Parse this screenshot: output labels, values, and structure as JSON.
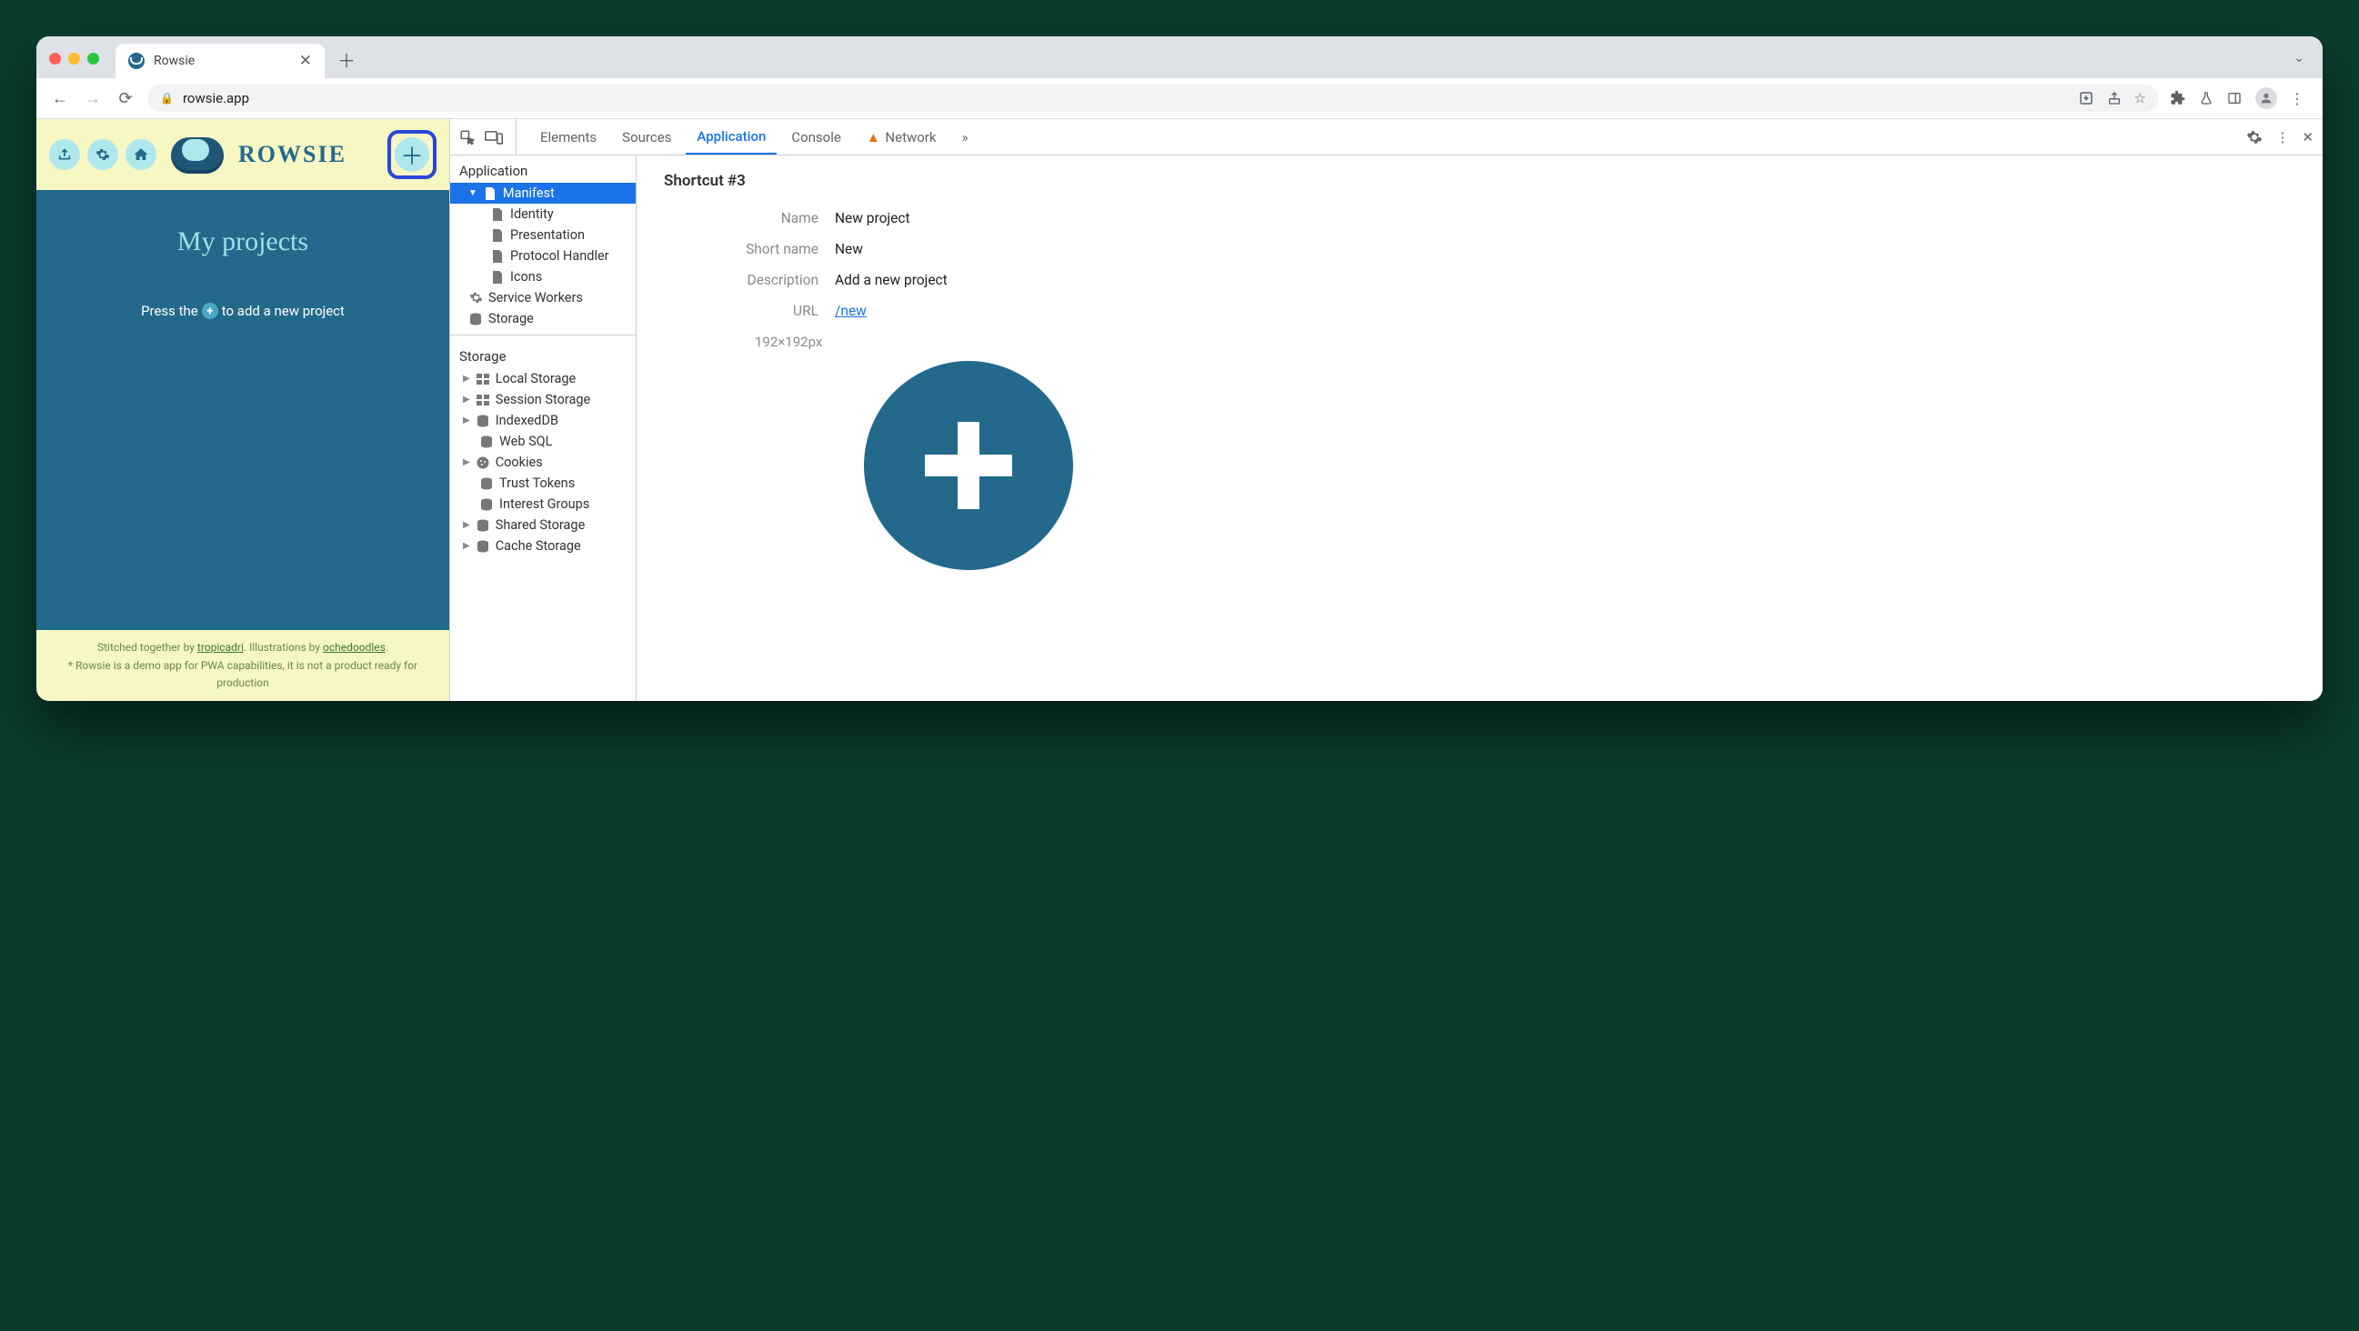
{
  "browser": {
    "tab_title": "Rowsie",
    "url": "rowsie.app"
  },
  "page": {
    "logo_text": "ROWSIE",
    "title": "My projects",
    "hint_before": "Press the",
    "hint_after": "to add a new project",
    "footer_line1_a": "Stitched together by ",
    "footer_link1": "tropicadri",
    "footer_line1_b": ". Illustrations by ",
    "footer_link2": "ochedoodles",
    "footer_line1_c": ".",
    "footer_line2": "* Rowsie is a demo app for PWA capabilities, it is not a product ready for production"
  },
  "devtools": {
    "tabs": [
      "Elements",
      "Sources",
      "Application",
      "Console",
      "Network"
    ],
    "active_tab": "Application",
    "more": "»",
    "side": {
      "group_app": "Application",
      "app_items": [
        "Manifest",
        "Identity",
        "Presentation",
        "Protocol Handler",
        "Icons",
        "Service Workers",
        "Storage"
      ],
      "group_storage": "Storage",
      "storage_items": [
        "Local Storage",
        "Session Storage",
        "IndexedDB",
        "Web SQL",
        "Cookies",
        "Trust Tokens",
        "Interest Groups",
        "Shared Storage",
        "Cache Storage"
      ]
    },
    "shortcut": {
      "heading": "Shortcut #3",
      "name_k": "Name",
      "name_v": "New project",
      "short_k": "Short name",
      "short_v": "New",
      "desc_k": "Description",
      "desc_v": "Add a new project",
      "url_k": "URL",
      "url_v": "/new",
      "px": "192×192px"
    }
  }
}
